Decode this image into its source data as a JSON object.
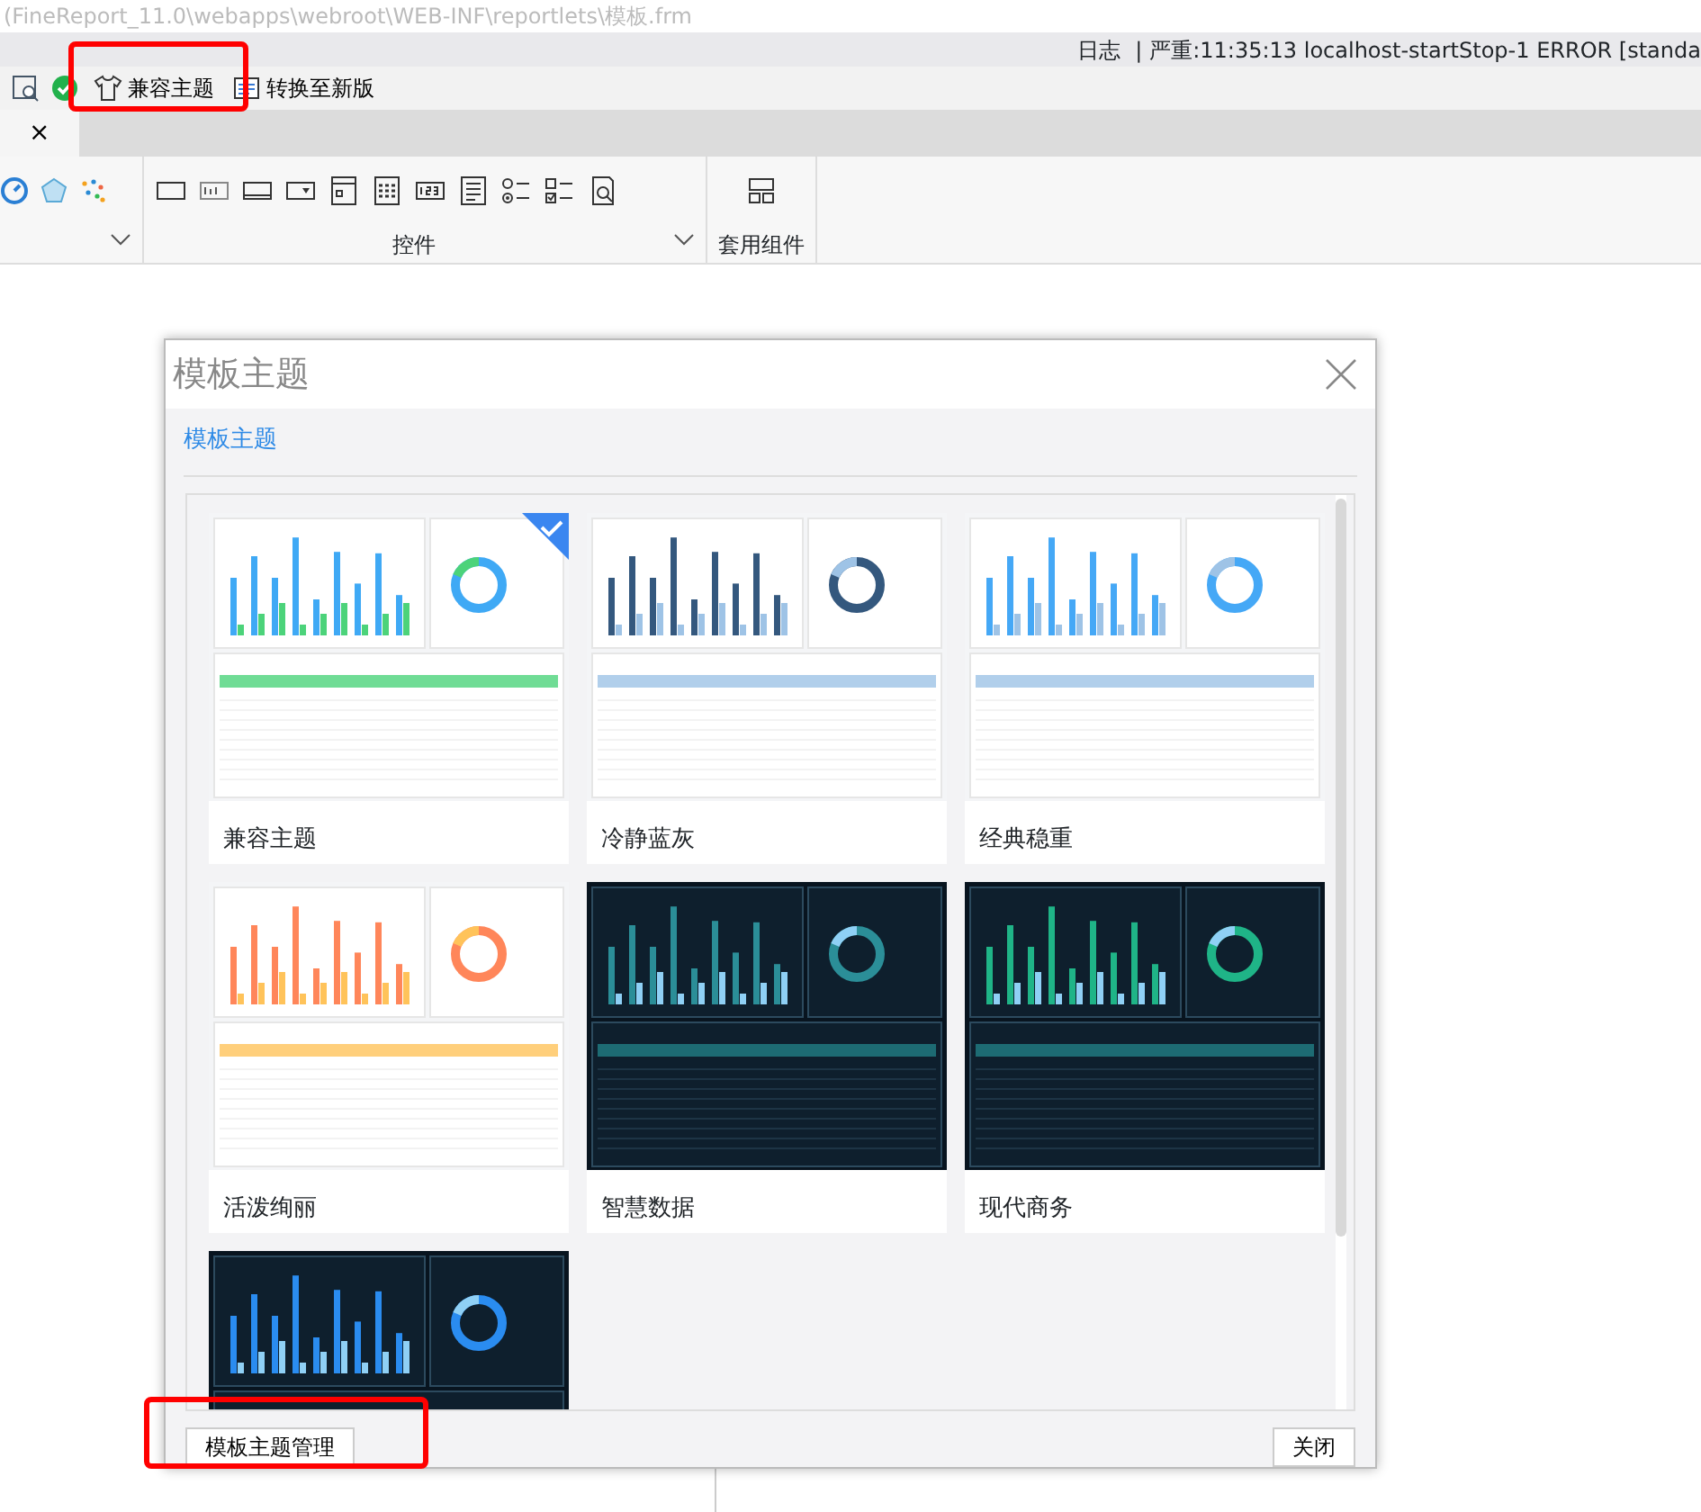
{
  "window": {
    "title": "(FineReport_11.0\\webapps\\webroot\\WEB-INF\\reportlets\\模板.frm"
  },
  "log_bar": {
    "label": "日志",
    "separator": "|",
    "message": "严重:11:35:13 localhost-startStop-1 ERROR [standa"
  },
  "toolbar": {
    "buttons": [
      "兼容主题",
      "转换至新版"
    ]
  },
  "document_tab": {
    "close": "×"
  },
  "ribbon": {
    "groups": [
      "控件",
      "套用组件"
    ]
  },
  "dialog": {
    "title": "模板主题",
    "tabs": [
      {
        "label": "模板主题",
        "selected": true
      }
    ],
    "themes": [
      {
        "name": "兼容主题",
        "selected": true,
        "kind": "light",
        "color": "#3fa9f5"
      },
      {
        "name": "冷静蓝灰",
        "selected": false,
        "kind": "light",
        "color": "#34587e"
      },
      {
        "name": "经典稳重",
        "selected": false,
        "kind": "light",
        "color": "#45a8f6"
      },
      {
        "name": "活泼绚丽",
        "selected": false,
        "kind": "light",
        "color": "#ff865a"
      },
      {
        "name": "智慧数据",
        "selected": false,
        "kind": "dark",
        "color": "#2b8e98"
      },
      {
        "name": "现代商务",
        "selected": false,
        "kind": "dark",
        "color": "#1fb487"
      },
      {
        "selected": false,
        "kind": "dark",
        "color": "#2a8cf0"
      }
    ],
    "buttons": [
      "模板主题管理",
      "关闭"
    ]
  }
}
